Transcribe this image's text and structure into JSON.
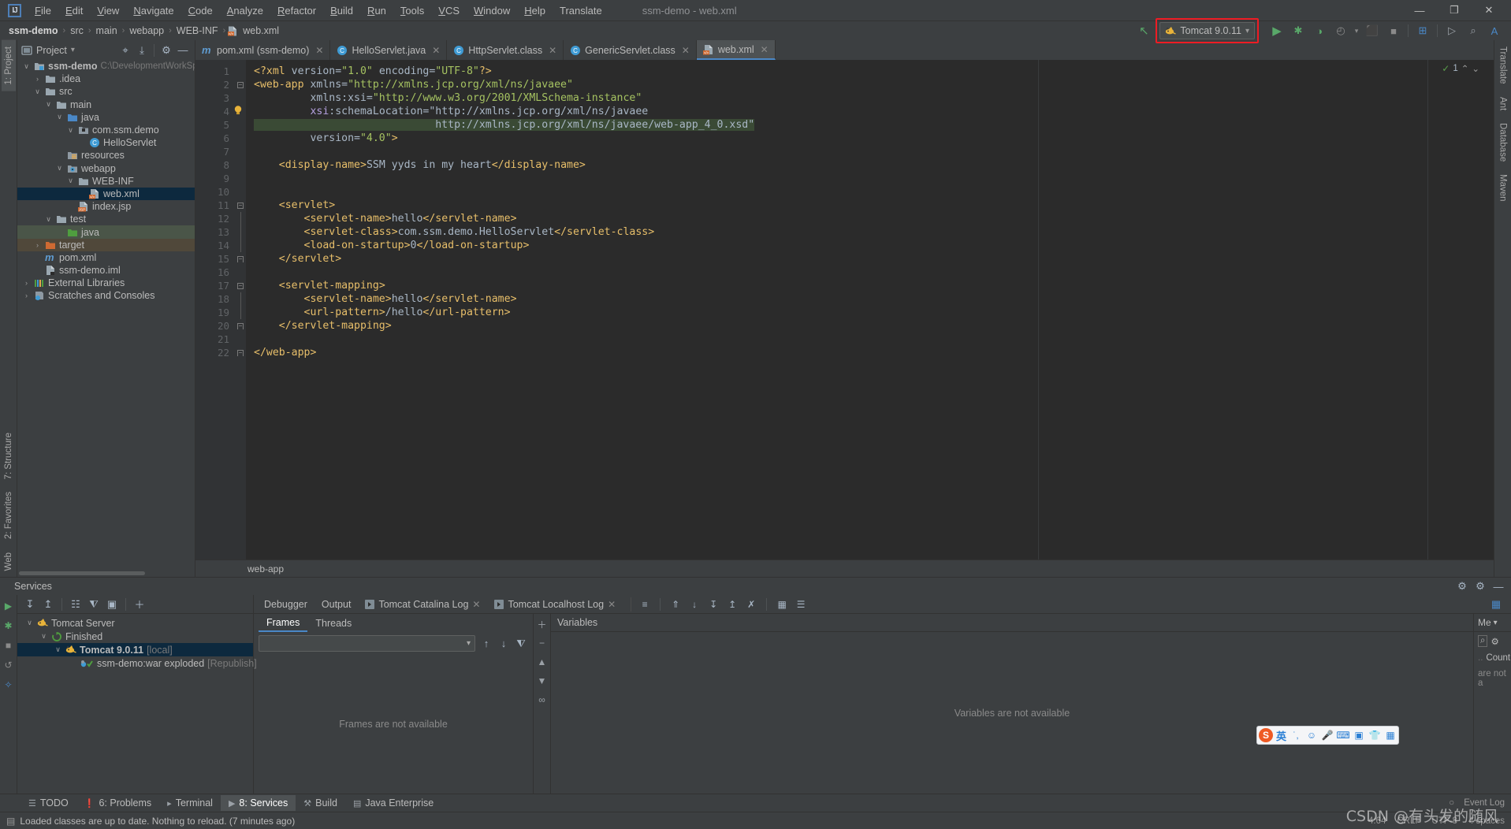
{
  "window": {
    "title": "ssm-demo - web.xml",
    "minimize_label": "—",
    "maximize_label": "❐",
    "close_label": "✕"
  },
  "menu": {
    "items": [
      "File",
      "Edit",
      "View",
      "Navigate",
      "Code",
      "Analyze",
      "Refactor",
      "Build",
      "Run",
      "Tools",
      "VCS",
      "Window",
      "Help",
      "Translate"
    ]
  },
  "breadcrumb": {
    "items": [
      "ssm-demo",
      "src",
      "main",
      "webapp",
      "WEB-INF",
      "web.xml"
    ],
    "separator": "›"
  },
  "toolbar": {
    "run_config_label": "Tomcat 9.0.11",
    "run_config_caret": "▾",
    "buttons": [
      {
        "name": "run-button",
        "glyph": "▶",
        "color": "#59a869"
      },
      {
        "name": "debug-button",
        "glyph": "✱",
        "color": "#59a869"
      },
      {
        "name": "run-with-coverage-button",
        "glyph": "◑",
        "color": "#59a869"
      },
      {
        "name": "profiler-button",
        "glyph": "◴",
        "color": "#8a8a8a"
      },
      {
        "name": "profiler-dropdown-icon",
        "glyph": "▾",
        "color": "#8a8a8a"
      },
      {
        "name": "stop-debug-button",
        "glyph": "⬛",
        "color": "#8a8a8a"
      },
      {
        "name": "stop-button",
        "glyph": "■",
        "color": "#8a8a8a"
      },
      {
        "name": "update-application-button",
        "glyph": "⊞",
        "color": "#4a88c7"
      },
      {
        "name": "run-dashboard-button",
        "glyph": "▷",
        "color": "#9aa0a6"
      },
      {
        "name": "search-everywhere-icon",
        "glyph": "⌕",
        "color": "#9aa0a6"
      },
      {
        "name": "translate-icon",
        "glyph": "A",
        "color": "#4a88c7"
      }
    ],
    "back_arrow_glyph": "↖",
    "highlight_color": "#ee1c24"
  },
  "left_stripe": {
    "top": [
      {
        "label": "1: Project",
        "name": "sidebar-tab-project",
        "active": true
      }
    ],
    "bottom": [
      {
        "label": "7: Structure",
        "name": "sidebar-tab-structure"
      },
      {
        "label": "2: Favorites",
        "name": "sidebar-tab-favorites"
      },
      {
        "label": "Web",
        "name": "sidebar-tab-web"
      }
    ]
  },
  "right_stripe": {
    "items": [
      {
        "label": "Translate",
        "name": "sidebar-tab-translate"
      },
      {
        "label": "Ant",
        "name": "sidebar-tab-ant"
      },
      {
        "label": "Database",
        "name": "sidebar-tab-database"
      },
      {
        "label": "Maven",
        "name": "sidebar-tab-maven"
      }
    ]
  },
  "project_panel": {
    "title": "Project",
    "title_caret": "▾",
    "header_icons": [
      {
        "name": "select-opened-file-icon",
        "glyph": "⌖"
      },
      {
        "name": "collapse-all-icon",
        "glyph": "⤓"
      },
      {
        "name": "settings-gear-icon",
        "glyph": "⚙"
      },
      {
        "name": "hide-icon",
        "glyph": "—"
      }
    ],
    "tree": [
      {
        "indent": 0,
        "arrow": "∨",
        "icon": "module",
        "label": "ssm-demo",
        "bold": true,
        "path": "C:\\DevelopmentWorkSpa",
        "state": "normal"
      },
      {
        "indent": 1,
        "arrow": "›",
        "icon": "folder-gray",
        "label": ".idea",
        "state": "normal"
      },
      {
        "indent": 1,
        "arrow": "∨",
        "icon": "folder-gray",
        "label": "src",
        "state": "normal"
      },
      {
        "indent": 2,
        "arrow": "∨",
        "icon": "folder-gray",
        "label": "main",
        "state": "normal"
      },
      {
        "indent": 3,
        "arrow": "∨",
        "icon": "folder-blue",
        "label": "java",
        "state": "normal"
      },
      {
        "indent": 4,
        "arrow": "∨",
        "icon": "package",
        "label": "com.ssm.demo",
        "state": "normal"
      },
      {
        "indent": 5,
        "arrow": "",
        "icon": "class",
        "label": "HelloServlet",
        "state": "normal"
      },
      {
        "indent": 3,
        "arrow": "",
        "icon": "resources",
        "label": "resources",
        "state": "normal"
      },
      {
        "indent": 3,
        "arrow": "∨",
        "icon": "webapp",
        "label": "webapp",
        "state": "normal"
      },
      {
        "indent": 4,
        "arrow": "∨",
        "icon": "folder-gray",
        "label": "WEB-INF",
        "state": "normal"
      },
      {
        "indent": 5,
        "arrow": "",
        "icon": "xml",
        "label": "web.xml",
        "state": "selected"
      },
      {
        "indent": 4,
        "arrow": "",
        "icon": "jsp",
        "label": "index.jsp",
        "state": "normal"
      },
      {
        "indent": 2,
        "arrow": "∨",
        "icon": "folder-gray",
        "label": "test",
        "state": "normal"
      },
      {
        "indent": 3,
        "arrow": "",
        "icon": "folder-green",
        "label": "java",
        "state": "green"
      },
      {
        "indent": 1,
        "arrow": "›",
        "icon": "folder-orange",
        "label": "target",
        "state": "brown"
      },
      {
        "indent": 1,
        "arrow": "",
        "icon": "maven",
        "label": "pom.xml",
        "state": "normal"
      },
      {
        "indent": 1,
        "arrow": "",
        "icon": "iml",
        "label": "ssm-demo.iml",
        "state": "normal"
      },
      {
        "indent": 0,
        "arrow": "›",
        "icon": "libraries",
        "label": "External Libraries",
        "state": "normal"
      },
      {
        "indent": 0,
        "arrow": "›",
        "icon": "scratches",
        "label": "Scratches and Consoles",
        "state": "normal"
      }
    ]
  },
  "editor": {
    "tabs": [
      {
        "label": "pom.xml (ssm-demo)",
        "icon": "maven",
        "active": false
      },
      {
        "label": "HelloServlet.java",
        "icon": "class",
        "active": false
      },
      {
        "label": "HttpServlet.class",
        "icon": "class-file",
        "active": false
      },
      {
        "label": "GenericServlet.class",
        "icon": "class-file",
        "active": false
      },
      {
        "label": "web.xml",
        "icon": "xml",
        "active": true
      }
    ],
    "close_glyph": "✕",
    "inspection_count": "1",
    "inspection_up": "⌃",
    "inspection_down": "⌄",
    "bottom_breadcrumb": "web-app",
    "lines": [
      {
        "n": 1,
        "fold": "",
        "text": "<?xml version=\"1.0\" encoding=\"UTF-8\"?>"
      },
      {
        "n": 2,
        "fold": "minus",
        "text": "<web-app xmlns=\"http://xmlns.jcp.org/xml/ns/javaee\""
      },
      {
        "n": 3,
        "fold": "",
        "text": "         xmlns:xsi=\"http://www.w3.org/2001/XMLSchema-instance\""
      },
      {
        "n": 4,
        "fold": "",
        "text": "         xsi:schemaLocation=\"http://xmlns.jcp.org/xml/ns/javaee"
      },
      {
        "n": 5,
        "fold": "",
        "text": "                             http://xmlns.jcp.org/xml/ns/javaee/web-app_4_0.xsd\""
      },
      {
        "n": 6,
        "fold": "",
        "text": "         version=\"4.0\">"
      },
      {
        "n": 7,
        "fold": "",
        "text": ""
      },
      {
        "n": 8,
        "fold": "",
        "text": "    <display-name>SSM yyds in my heart</display-name>"
      },
      {
        "n": 9,
        "fold": "",
        "text": ""
      },
      {
        "n": 10,
        "fold": "",
        "text": ""
      },
      {
        "n": 11,
        "fold": "minus",
        "text": "    <servlet>"
      },
      {
        "n": 12,
        "fold": "line",
        "text": "        <servlet-name>hello</servlet-name>"
      },
      {
        "n": 13,
        "fold": "line",
        "text": "        <servlet-class>com.ssm.demo.HelloServlet</servlet-class>"
      },
      {
        "n": 14,
        "fold": "line",
        "text": "        <load-on-startup>0</load-on-startup>"
      },
      {
        "n": 15,
        "fold": "end",
        "text": "    </servlet>"
      },
      {
        "n": 16,
        "fold": "",
        "text": ""
      },
      {
        "n": 17,
        "fold": "minus",
        "text": "    <servlet-mapping>"
      },
      {
        "n": 18,
        "fold": "line",
        "text": "        <servlet-name>hello</servlet-name>"
      },
      {
        "n": 19,
        "fold": "line",
        "text": "        <url-pattern>/hello</url-pattern>"
      },
      {
        "n": 20,
        "fold": "end",
        "text": "    </servlet-mapping>"
      },
      {
        "n": 21,
        "fold": "",
        "text": ""
      },
      {
        "n": 22,
        "fold": "end",
        "text": "</web-app>"
      }
    ]
  },
  "services": {
    "title": "Services",
    "header_icons": [
      {
        "name": "settings-gear-icon",
        "glyph": "⚙"
      },
      {
        "name": "options-gear-icon",
        "glyph": "⚙"
      },
      {
        "name": "hide-icon",
        "glyph": "—"
      }
    ],
    "left_toolbar": [
      {
        "name": "run-service-icon",
        "glyph": "▶",
        "color": "#59a869"
      },
      {
        "name": "debug-service-icon",
        "glyph": "✱",
        "color": "#59a869"
      },
      {
        "name": "stop-service-icon",
        "glyph": "■",
        "color": "#8a8a8a"
      },
      {
        "name": "rerun-service-icon",
        "glyph": "↺",
        "color": "#8a8a8a"
      },
      {
        "name": "add-service-icon",
        "glyph": "✧",
        "color": "#4a88c7"
      }
    ],
    "tree_toolbar": [
      {
        "name": "expand-all-icon",
        "glyph": "↧"
      },
      {
        "name": "collapse-all-icon",
        "glyph": "↥"
      },
      {
        "name": "group-icon",
        "glyph": "☷"
      },
      {
        "name": "filter-icon",
        "glyph": "⧨"
      },
      {
        "name": "show-options-icon",
        "glyph": "▣"
      },
      {
        "name": "add-icon",
        "glyph": "＋"
      }
    ],
    "tree": [
      {
        "indent": 0,
        "arrow": "∨",
        "icon": "tomcat",
        "label": "Tomcat Server",
        "suffix": "",
        "state": "normal"
      },
      {
        "indent": 1,
        "arrow": "∨",
        "icon": "finished",
        "label": "Finished",
        "suffix": "",
        "state": "normal"
      },
      {
        "indent": 2,
        "arrow": "∨",
        "icon": "tomcat",
        "label": "Tomcat 9.0.11",
        "suffix": "[local]",
        "state": "selected",
        "bold": true
      },
      {
        "indent": 3,
        "arrow": "",
        "icon": "artifact",
        "label": "ssm-demo:war exploded",
        "suffix": "[Republish]",
        "state": "normal"
      }
    ],
    "debug_tabs": [
      {
        "label": "Debugger",
        "active": false,
        "closable": false
      },
      {
        "label": "Output",
        "active": false,
        "closable": false
      },
      {
        "label": "Tomcat Catalina Log",
        "active": false,
        "closable": true
      },
      {
        "label": "Tomcat Localhost Log",
        "active": false,
        "closable": true
      }
    ],
    "debug_tab_icons": [
      {
        "name": "soft-wrap-icon",
        "glyph": "≡"
      },
      {
        "name": "scroll-to-top-icon",
        "glyph": "⇑"
      },
      {
        "name": "step-down-icon",
        "glyph": "↓"
      },
      {
        "name": "scroll-to-end-icon",
        "glyph": "↧"
      },
      {
        "name": "scroll-to-start-icon",
        "glyph": "↥"
      },
      {
        "name": "mute-breakpoints-icon",
        "glyph": "✗"
      },
      {
        "name": "print-icon",
        "glyph": "▦"
      },
      {
        "name": "clear-all-icon",
        "glyph": "☰"
      }
    ],
    "frames": {
      "tabs": [
        {
          "label": "Frames",
          "active": true
        },
        {
          "label": "Threads",
          "active": false
        }
      ],
      "thread_selector_value": "",
      "thread_selector_caret": "▾",
      "toolbar": [
        {
          "name": "frame-up-icon",
          "glyph": "↑"
        },
        {
          "name": "frame-down-icon",
          "glyph": "↓"
        },
        {
          "name": "frames-filter-icon",
          "glyph": "⧨"
        }
      ],
      "empty_text": "Frames are not available"
    },
    "side_toolbar": [
      {
        "name": "add-watch-icon",
        "glyph": "＋"
      },
      {
        "name": "remove-watch-icon",
        "glyph": "−"
      },
      {
        "name": "move-up-icon",
        "glyph": "▲"
      },
      {
        "name": "move-down-icon",
        "glyph": "▼"
      },
      {
        "name": "watches-icon",
        "glyph": "∞"
      }
    ],
    "variables": {
      "title": "Variables",
      "empty_text": "Variables are not available"
    },
    "memory": {
      "title": "Me",
      "caret": "▾",
      "icons": [
        {
          "name": "search-icon",
          "glyph": "⌕"
        },
        {
          "name": "settings-gear-icon",
          "glyph": "⚙"
        }
      ],
      "column_header": "Count",
      "empty_text": "are not a"
    }
  },
  "bottom_bar": {
    "tabs": [
      {
        "label": "TODO",
        "icon": "todo-icon",
        "glyph": "☰",
        "active": false
      },
      {
        "label": "6: Problems",
        "icon": "problems-icon",
        "glyph": "❗",
        "active": false
      },
      {
        "label": "Terminal",
        "icon": "terminal-icon",
        "glyph": "▸",
        "active": false
      },
      {
        "label": "8: Services",
        "icon": "services-icon",
        "glyph": "▶",
        "active": true
      },
      {
        "label": "Build",
        "icon": "build-icon",
        "glyph": "⚒",
        "active": false
      },
      {
        "label": "Java Enterprise",
        "icon": "java-enterprise-icon",
        "glyph": "▤",
        "active": false
      }
    ],
    "event_log": "Event Log",
    "event_log_icon": "○"
  },
  "status_bar": {
    "icon": "▤",
    "message": "Loaded classes are up to date. Nothing to reload. (7 minutes ago)",
    "caret_position": "4:64",
    "line_separator": "CRLF",
    "encoding": "UTF-8",
    "indent": "4 spaces"
  },
  "ime": {
    "logo": "S",
    "mode": "英",
    "items": [
      {
        "name": "ime-punctuation-icon",
        "glyph": "˙,"
      },
      {
        "name": "ime-emoji-icon",
        "glyph": "☻"
      },
      {
        "name": "ime-voice-icon",
        "glyph": "Ἲ4"
      },
      {
        "name": "ime-keyboard-icon",
        "glyph": "⌨"
      },
      {
        "name": "ime-screenshot-icon",
        "glyph": "⊞"
      },
      {
        "name": "ime-skin-icon",
        "glyph": "◆"
      },
      {
        "name": "ime-toolbox-icon",
        "glyph": "⊞"
      }
    ]
  },
  "watermark": {
    "text": "CSDN @有头发的随风"
  }
}
